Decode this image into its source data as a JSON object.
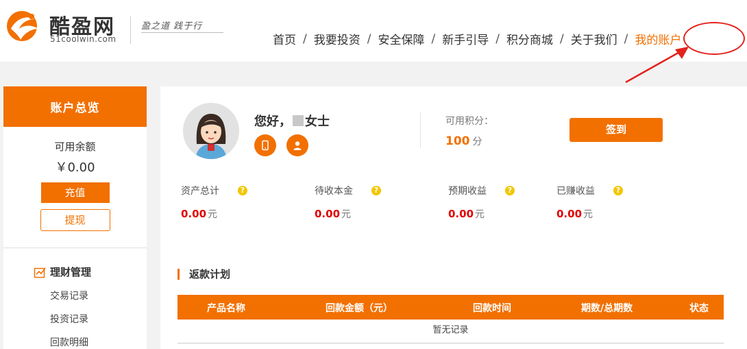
{
  "header": {
    "brand": "酷盈网",
    "brand_domain": "51coolwin.com",
    "slogan": "盈之道  践于行",
    "nav": [
      {
        "label": "首页",
        "active": false
      },
      {
        "label": "我要投资",
        "active": false
      },
      {
        "label": "安全保障",
        "active": false
      },
      {
        "label": "新手引导",
        "active": false
      },
      {
        "label": "积分商城",
        "active": false
      },
      {
        "label": "关于我们",
        "active": false
      },
      {
        "label": "我的账户",
        "active": true
      }
    ],
    "nav_separator": "/"
  },
  "sidebar": {
    "title": "账户总览",
    "balance_label": "可用余额",
    "balance_value": "￥0.00",
    "recharge_label": "充值",
    "withdraw_label": "提现",
    "menu_title": "理财管理",
    "menu_items": [
      "交易记录",
      "投资记录",
      "回款明细"
    ]
  },
  "profile": {
    "greeting_prefix": "您好，",
    "greeting_suffix": "女士",
    "points_label": "可用积分：",
    "points_value": "100",
    "points_unit": "分",
    "sign_in_label": "签到"
  },
  "stats": [
    {
      "label": "资产总计",
      "value": "0.00",
      "unit": "元"
    },
    {
      "label": "待收本金",
      "value": "0.00",
      "unit": "元"
    },
    {
      "label": "预期收益",
      "value": "0.00",
      "unit": "元"
    },
    {
      "label": "已赚收益",
      "value": "0.00",
      "unit": "元"
    }
  ],
  "repayment_plan": {
    "title": "返款计划",
    "columns": [
      "产品名称",
      "回款金额（元）",
      "回款时间",
      "期数/总期数",
      "状态"
    ],
    "empty_text": "暂无记录"
  },
  "colors": {
    "accent": "#f27000",
    "value_red": "#e10000",
    "annotation_red": "#e3221d",
    "help_yellow": "#f3c600"
  }
}
